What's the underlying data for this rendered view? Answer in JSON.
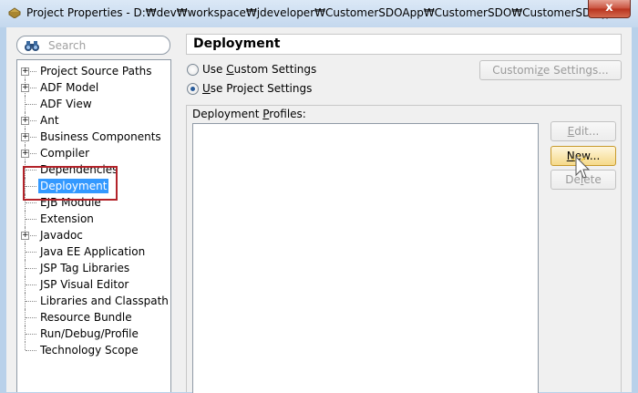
{
  "window": {
    "title": "Project Properties - D:₩dev₩workspace₩jdeveloper₩CustomerSDOApp₩CustomerSDO₩CustomerSDO.jpr",
    "close_label": "x"
  },
  "search": {
    "placeholder": "Search"
  },
  "tree": {
    "items": [
      {
        "label": "Project Source Paths",
        "expandable": true
      },
      {
        "label": "ADF Model",
        "expandable": true
      },
      {
        "label": "ADF View",
        "expandable": false
      },
      {
        "label": "Ant",
        "expandable": true
      },
      {
        "label": "Business Components",
        "expandable": true
      },
      {
        "label": "Compiler",
        "expandable": true
      },
      {
        "label": "Dependencies",
        "expandable": false
      },
      {
        "label": "Deployment",
        "expandable": false,
        "selected": true
      },
      {
        "label": "EJB Module",
        "expandable": false
      },
      {
        "label": "Extension",
        "expandable": false
      },
      {
        "label": "Javadoc",
        "expandable": true
      },
      {
        "label": "Java EE Application",
        "expandable": false
      },
      {
        "label": "JSP Tag Libraries",
        "expandable": false
      },
      {
        "label": "JSP Visual Editor",
        "expandable": false
      },
      {
        "label": "Libraries and Classpath",
        "expandable": false
      },
      {
        "label": "Resource Bundle",
        "expandable": false
      },
      {
        "label": "Run/Debug/Profile",
        "expandable": false
      },
      {
        "label": "Technology Scope",
        "expandable": false
      }
    ]
  },
  "panel": {
    "title": "Deployment",
    "radio_custom": {
      "pre": "Use ",
      "key": "C",
      "post": "ustom Settings",
      "checked": false
    },
    "radio_project": {
      "pre": "",
      "key": "U",
      "post": "se Project Settings",
      "checked": true
    },
    "customize_button": {
      "pre": "Customi",
      "key": "z",
      "post": "e Settings..."
    },
    "profiles_label": {
      "pre": "Deployment ",
      "key": "P",
      "post": "rofiles:"
    },
    "edit_button": {
      "pre": "",
      "key": "E",
      "post": "dit..."
    },
    "new_button": {
      "pre": "",
      "key": "N",
      "post": "ew..."
    },
    "delete_button": {
      "pre": "De",
      "key": "l",
      "post": "ete"
    }
  },
  "colors": {
    "selection": "#3399ff",
    "highlight_box": "#b3232a",
    "title_bar": "#c4d8ee"
  }
}
